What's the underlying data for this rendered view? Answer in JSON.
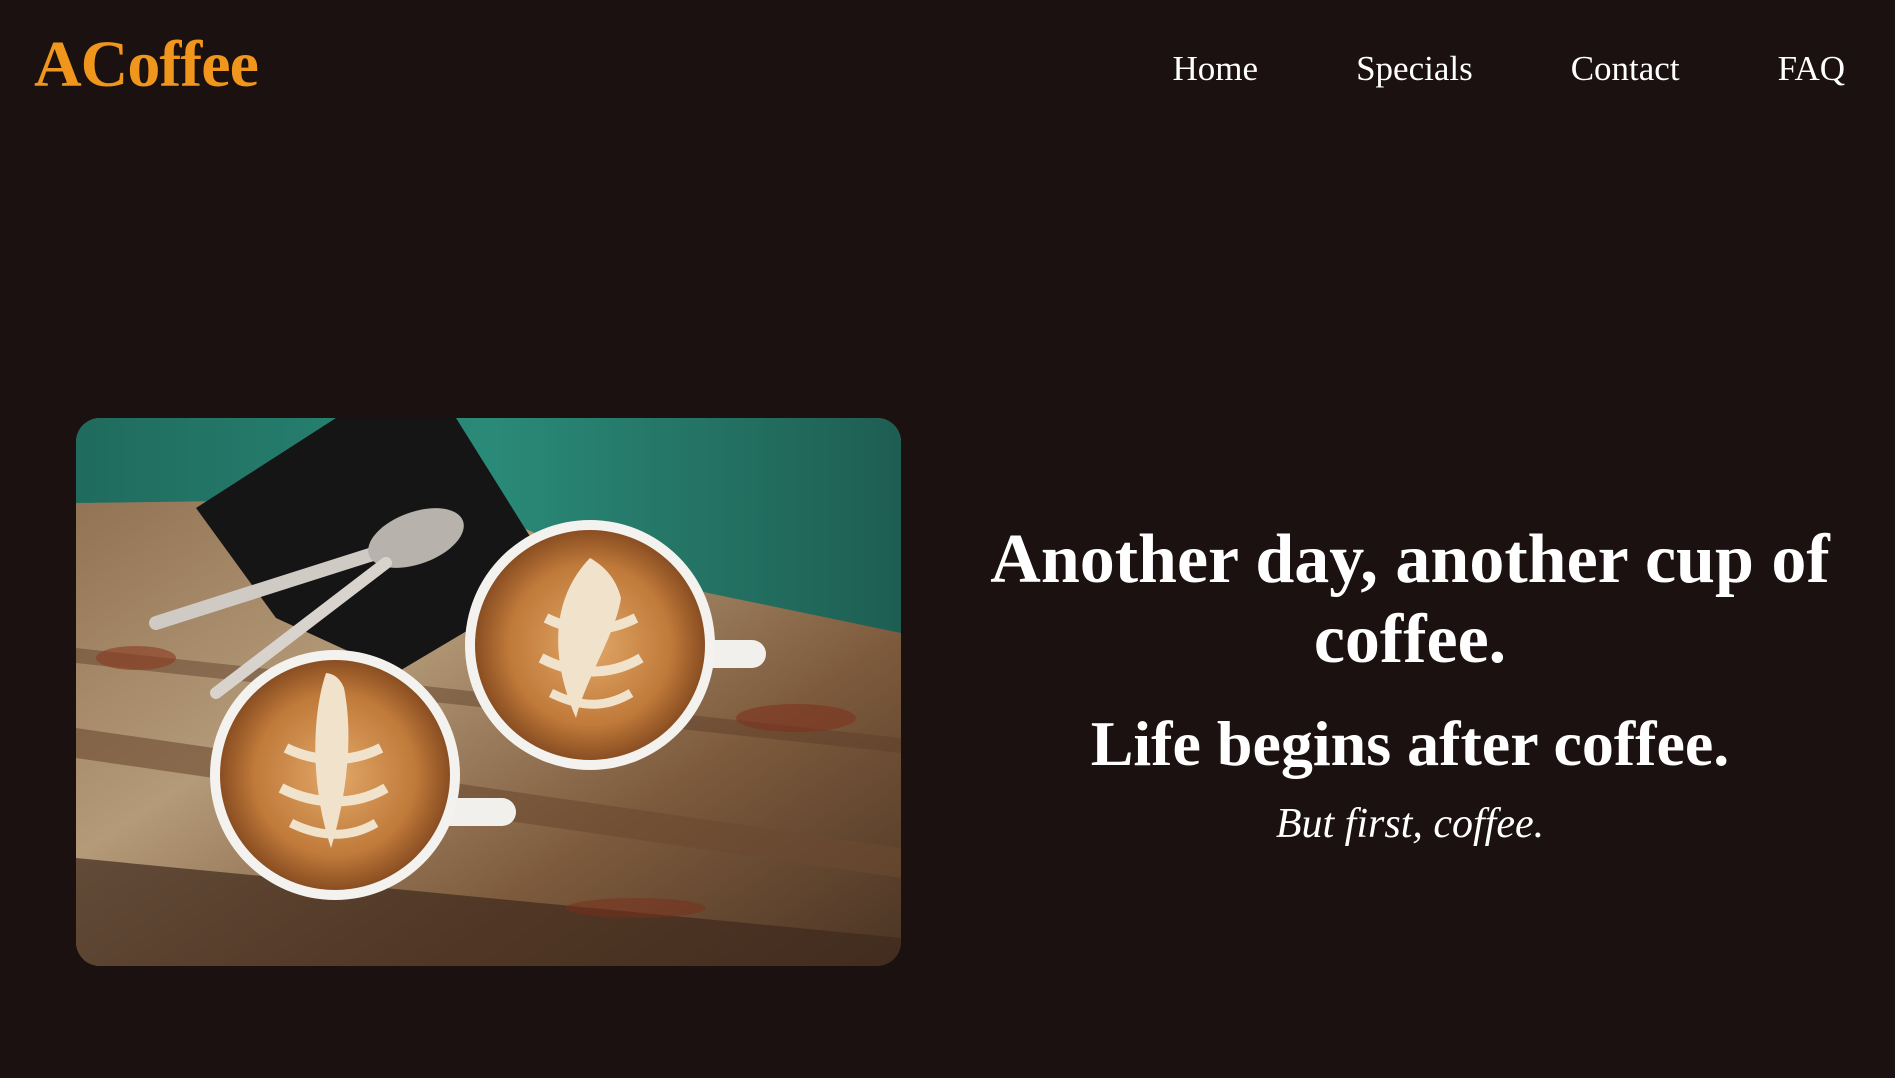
{
  "brand": {
    "name": "ACoffee",
    "color": "#f0961c"
  },
  "nav": {
    "items": [
      {
        "label": "Home"
      },
      {
        "label": "Specials"
      },
      {
        "label": "Contact"
      },
      {
        "label": "FAQ"
      }
    ]
  },
  "hero": {
    "image_icon": "latte-art-photo",
    "title": "Another day, another cup of coffee.",
    "subtitle": "Life begins after coffee.",
    "tagline": "But first, coffee."
  },
  "colors": {
    "background": "#1a1110",
    "text": "#ffffff",
    "accent": "#f0961c"
  }
}
